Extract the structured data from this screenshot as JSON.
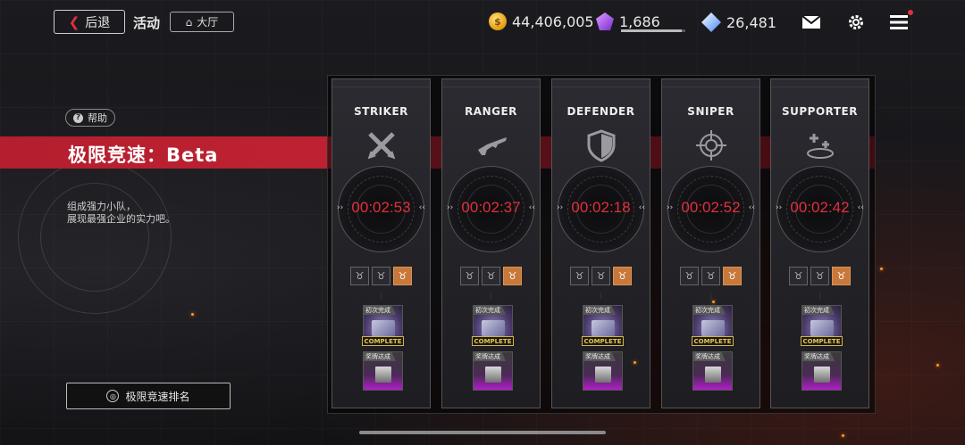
{
  "header": {
    "back_label": "后退",
    "title": "活动",
    "hall_label": "大厅",
    "currencies": [
      {
        "icon": "gold-coin-icon",
        "value": "44,406,005"
      },
      {
        "icon": "purple-gem-icon",
        "value": "1,686",
        "progress": 0.95
      },
      {
        "icon": "diamond-icon",
        "value": "26,481"
      }
    ],
    "icons": [
      "mail-icon",
      "settings-gear-icon",
      "menu-icon"
    ]
  },
  "left": {
    "help_label": "帮助",
    "event_title": "极限竞速：Beta",
    "description_line1": "组成强力小队，",
    "description_line2": "展现最强企业的实力吧。",
    "ranking_button": "极限竞速排名"
  },
  "cards": [
    {
      "role": "STRIKER",
      "icon": "crossed-swords-icon",
      "time": "00:02:53",
      "reward1_label": "初次完成",
      "reward1_status": "COMPLETE",
      "reward2_label": "奖牌达成"
    },
    {
      "role": "RANGER",
      "icon": "rifle-icon",
      "time": "00:02:37",
      "reward1_label": "初次完成",
      "reward1_status": "COMPLETE",
      "reward2_label": "奖牌达成"
    },
    {
      "role": "DEFENDER",
      "icon": "shield-icon",
      "time": "00:02:18",
      "reward1_label": "初次完成",
      "reward1_status": "COMPLETE",
      "reward2_label": "奖牌达成"
    },
    {
      "role": "SNIPER",
      "icon": "crosshair-icon",
      "time": "00:02:52",
      "reward1_label": "初次完成",
      "reward1_status": "COMPLETE",
      "reward2_label": "奖牌达成"
    },
    {
      "role": "SUPPORTER",
      "icon": "heal-plus-icon",
      "time": "00:02:42",
      "reward1_label": "初次完成",
      "reward1_status": "COMPLETE",
      "reward2_label": "奖牌达成"
    }
  ],
  "colors": {
    "accent_red": "#c42534",
    "timer_red": "#e0303c",
    "medal_gold": "#c8783a",
    "complete_gold": "#e8c850"
  }
}
